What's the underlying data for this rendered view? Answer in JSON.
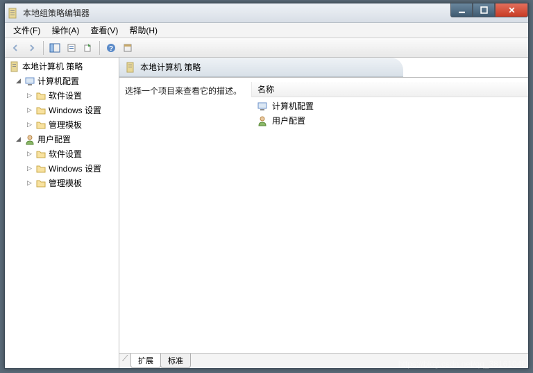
{
  "window": {
    "title": "本地组策略编辑器"
  },
  "menubar": {
    "file": "文件(F)",
    "action": "操作(A)",
    "view": "查看(V)",
    "help": "帮助(H)"
  },
  "tree": {
    "root": "本地计算机 策略",
    "computer": "计算机配置",
    "user": "用户配置",
    "software": "软件设置",
    "windows": "Windows 设置",
    "admin": "管理模板"
  },
  "detail": {
    "header": "本地计算机 策略",
    "description": "选择一个项目来查看它的描述。",
    "column_name": "名称",
    "items": {
      "computer": "计算机配置",
      "user": "用户配置"
    }
  },
  "tabs": {
    "extended": "扩展",
    "standard": "标准"
  },
  "watermark": "https://blog.csdn.net/qq_38161040"
}
